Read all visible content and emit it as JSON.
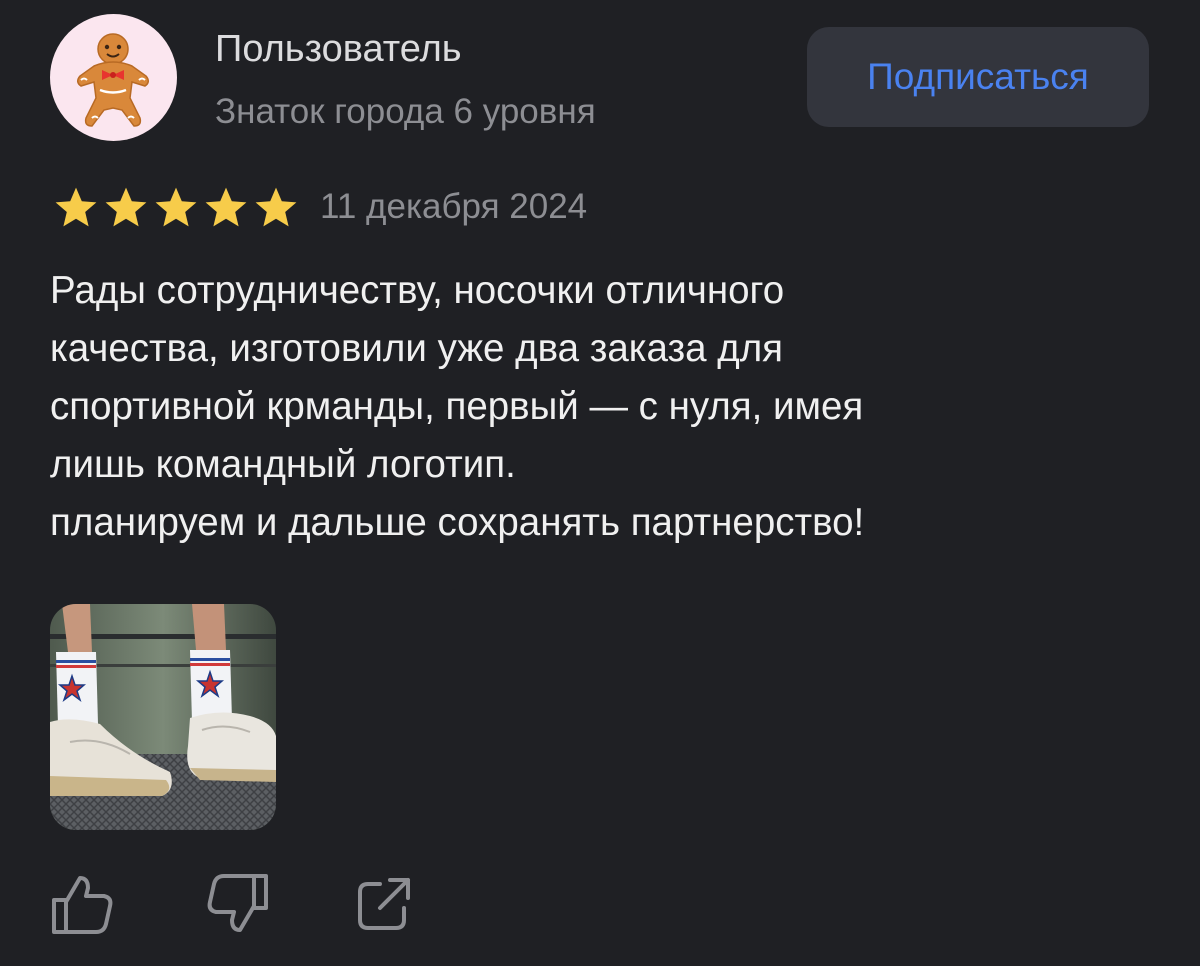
{
  "user": {
    "name": "Пользователь",
    "level": "Знаток города 6 уровня",
    "avatar_icon": "gingerbread-man-icon"
  },
  "subscribe": {
    "label": "Подписаться"
  },
  "review": {
    "rating": 5,
    "rating_max": 5,
    "date": "11 декабря 2024",
    "text_lines": [
      "Рады сотрудничеству, носочки отличного",
      "качества, изготовили уже два заказа для",
      "спортивной крманды, первый — с нуля, имея",
      "лишь командный логотип.",
      "планируем и дальше сохранять партнерство!"
    ]
  },
  "photos": [
    {
      "subject": "socks-with-star-logo-photo"
    }
  ],
  "actions": [
    {
      "icon": "thumbs-up-icon"
    },
    {
      "icon": "thumbs-down-icon"
    },
    {
      "icon": "share-icon"
    }
  ],
  "colors": {
    "background": "#1f2024",
    "accent": "#4a82f0",
    "button_bg": "#33353d",
    "star": "#f7cc4a",
    "muted_text": "#8d8e93"
  }
}
